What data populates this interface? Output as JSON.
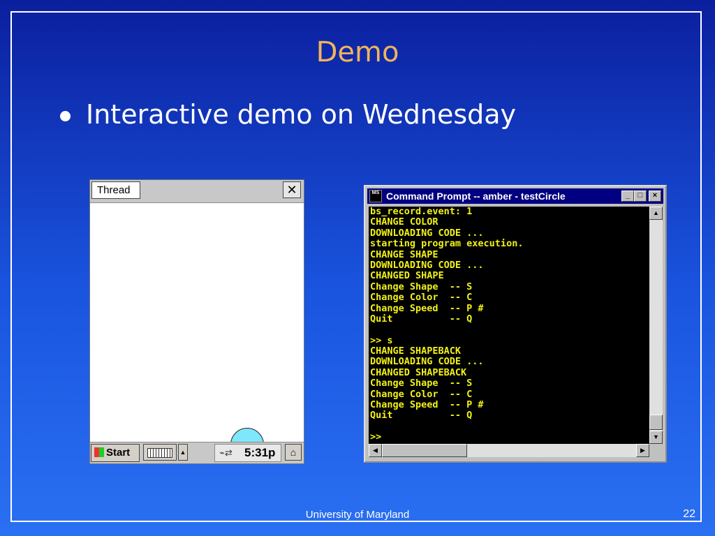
{
  "slide": {
    "title": "Demo",
    "bullets": [
      "Interactive demo on Wednesday"
    ],
    "footer": "University of Maryland",
    "page_number": "22"
  },
  "pda": {
    "title": "Thread",
    "close_glyph": "✕",
    "start_label": "Start",
    "clock": "5:31p",
    "circle_color": "#7fe7fb"
  },
  "cmd": {
    "icon_text": "MS",
    "title": "Command Prompt -- amber - testCircle",
    "buttons": {
      "minimize": "_",
      "maximize": "□",
      "close": "×"
    },
    "text_color": "#f2f218",
    "lines": [
      "bs_record.event: 1",
      "CHANGE COLOR",
      "DOWNLOADING CODE ...",
      "starting program execution.",
      "CHANGE SHAPE",
      "DOWNLOADING CODE ...",
      "CHANGED SHAPE",
      "Change Shape  -- S",
      "Change Color  -- C",
      "Change Speed  -- P #",
      "Quit          -- Q",
      "",
      ">> s",
      "CHANGE SHAPEBACK",
      "DOWNLOADING CODE ...",
      "CHANGED SHAPEBACK",
      "Change Shape  -- S",
      "Change Color  -- C",
      "Change Speed  -- P #",
      "Quit          -- Q",
      "",
      ">>"
    ]
  }
}
